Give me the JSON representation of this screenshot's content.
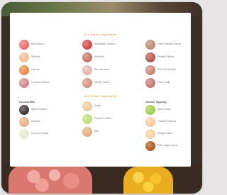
{
  "section_top": {
    "title": "ALL Recipe Ingredients"
  },
  "section_bottom": {
    "title": "ALL Recipe Ingredients"
  },
  "top_col1": [
    {
      "label": "Red Beans",
      "color": "#ec6f72"
    },
    {
      "label": "Shallots",
      "color": "#f2bf97"
    },
    {
      "label": "Carrots",
      "color": "#ef8a4b"
    },
    {
      "label": "Crushed Shrimp",
      "color": "#d78a8f"
    }
  ],
  "top_col2": [
    {
      "label": "Shredded Chicken",
      "color": "#d4474b"
    },
    {
      "label": "Almonds",
      "color": "#c97469"
    },
    {
      "label": "Rice Noodles",
      "color": "#e7b7aa"
    },
    {
      "label": "Shrimp Paste",
      "color": "#d8957f"
    }
  ],
  "top_col3": [
    {
      "label": "Dried Sesame Seeds",
      "color": "#b79077"
    },
    {
      "label": "Pickled Daikon",
      "color": "#b9584f"
    },
    {
      "label": "Red Chili Flakes",
      "color": "#cd8778"
    },
    {
      "label": "Fried Garlic",
      "color": "#c57a72"
    }
  ],
  "bottom_group1": "Coconut Milk",
  "bottom_group3": "Garnish Toppings",
  "bottom_col1": [
    {
      "label": "Black Sesame",
      "color": "#3d3637"
    },
    {
      "label": "Shallots",
      "color": "#e9b487"
    },
    {
      "label": "Coconut Flakes",
      "color": "#e3ebcf"
    }
  ],
  "bottom_col2": [
    {
      "label": "Sugar",
      "color": "#f3cc9e"
    },
    {
      "label": "Pandan Leaves",
      "color": "#bfe07a"
    },
    {
      "label": "Salt",
      "color": "#e3b27f"
    }
  ],
  "bottom_col3": [
    {
      "label": "Mint Leaves",
      "color": "#9ed24c"
    },
    {
      "label": "Toasted Peanuts",
      "color": "#f4ce9f"
    },
    {
      "label": "Mango Slices",
      "color": "#f2d4a4"
    },
    {
      "label": "Palm Sugar Syrup",
      "color": "#b65a21"
    }
  ]
}
